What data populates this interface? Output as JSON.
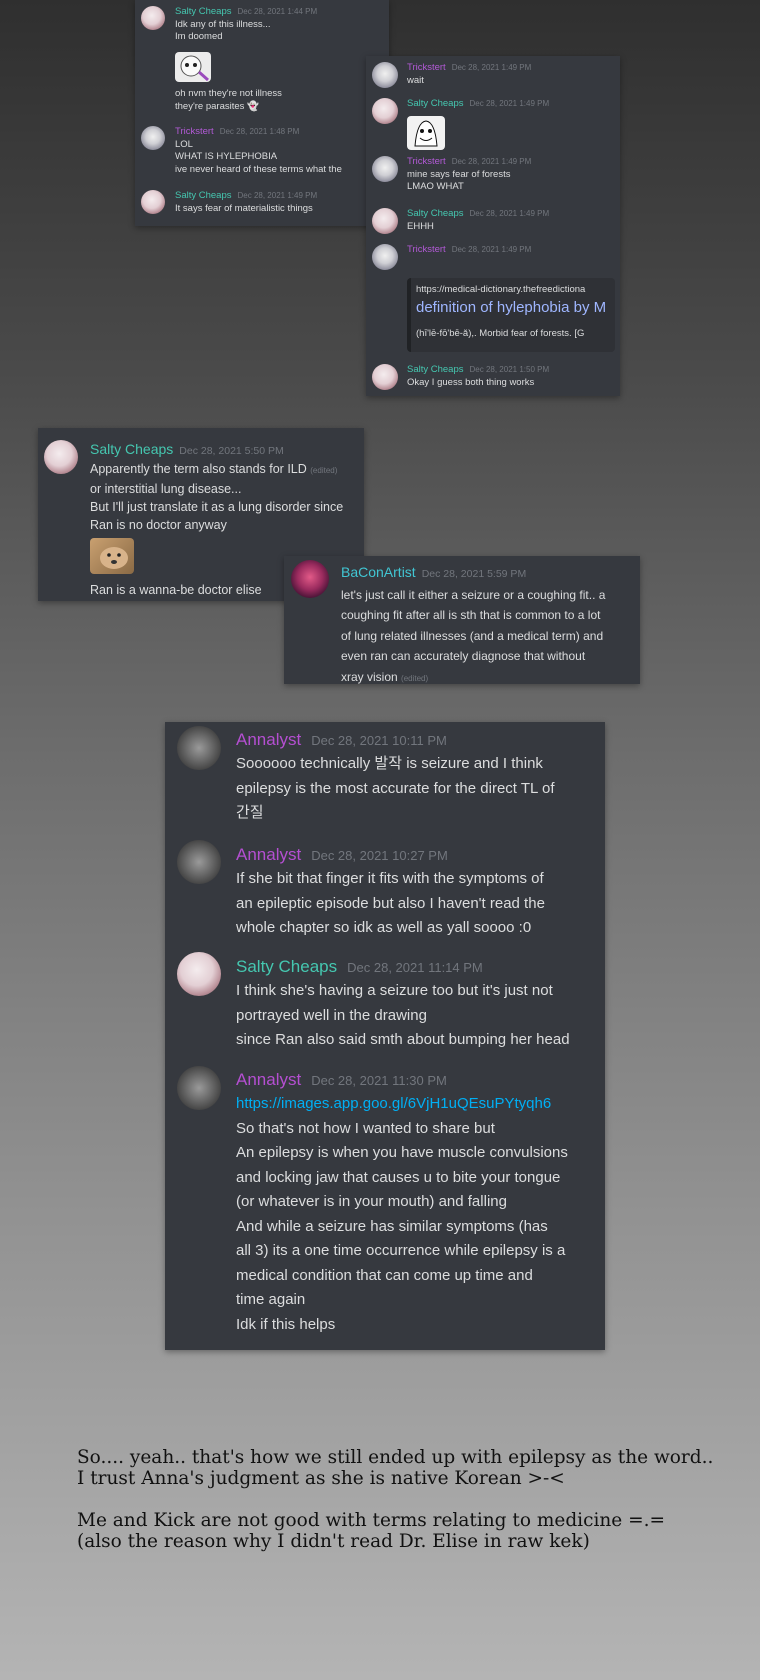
{
  "panel1": {
    "messages": [
      {
        "author": "Salty Cheaps",
        "time": "Dec 28, 2021 1:44 PM",
        "lines": [
          "Idk any of this illness...",
          "Im doomed"
        ]
      },
      {
        "lines": [
          "oh nvm they're not illness",
          "they're parasites"
        ]
      },
      {
        "author": "Trickstert",
        "time": "Dec 28, 2021 1:48 PM",
        "lines": [
          "LOL",
          "WHAT IS HYLEPHOBIA",
          "ive never heard of these terms what the"
        ]
      },
      {
        "author": "Salty Cheaps",
        "time": "Dec 28, 2021 1:49 PM",
        "lines": [
          "It says fear of materialistic things"
        ]
      }
    ]
  },
  "panel2": {
    "messages": [
      {
        "author": "Trickstert",
        "time": "Dec 28, 2021 1:49 PM",
        "lines": [
          "wait"
        ]
      },
      {
        "author": "Salty Cheaps",
        "time": "Dec 28, 2021 1:49 PM",
        "lines": []
      },
      {
        "author": "Trickstert",
        "time": "Dec 28, 2021 1:49 PM",
        "lines": [
          "mine says fear of forests",
          "LMAO WHAT"
        ]
      },
      {
        "author": "Salty Cheaps",
        "time": "Dec 28, 2021 1:49 PM",
        "lines": [
          "EHHH"
        ]
      },
      {
        "author": "Trickstert",
        "time": "Dec 28, 2021 1:49 PM",
        "lines": []
      },
      {
        "author": "Salty Cheaps",
        "time": "Dec 28, 2021 1:50 PM",
        "lines": [
          "Okay I guess both thing works"
        ]
      }
    ],
    "embed": {
      "url": "https://medical-dictionary.thefreedictiona",
      "title": "definition of hylephobia by M",
      "desc": "(hī'lē-fō'bē-ă),. Morbid fear of forests. [G"
    }
  },
  "panel3": {
    "author": "Salty Cheaps",
    "time": "Dec 28, 2021 5:50 PM",
    "edited": "(edited)",
    "lines": [
      "Apparently the term also stands for ILD",
      "or interstitial lung disease...",
      "But I'll just translate it as a lung disorder since",
      "Ran is no doctor anyway"
    ],
    "after": "Ran is a wanna-be doctor elise"
  },
  "panel4": {
    "author": "BaConArtist",
    "time": "Dec 28, 2021 5:59 PM",
    "edited": "(edited)",
    "lines": [
      "let's just call it either a seizure or a coughing fit.. a",
      "coughing fit after all is sth that is common to a lot",
      "of lung related illnesses (and a medical term) and",
      "even ran can accurately diagnose that without",
      "xray vision"
    ]
  },
  "panel5": {
    "messages": [
      {
        "author": "Annalyst",
        "time": "Dec 28, 2021 10:11 PM",
        "lines": [
          "Soooooo technically 발작 is seizure and I think",
          "epilepsy is the most accurate for the direct TL of",
          "간질"
        ]
      },
      {
        "author": "Annalyst",
        "time": "Dec 28, 2021 10:27 PM",
        "lines": [
          "If she bit that finger it fits with the symptoms of",
          "an epileptic episode but also I haven't read the",
          "whole chapter so idk as well as yall soooo :0"
        ]
      },
      {
        "author": "Salty Cheaps",
        "time": "Dec 28, 2021 11:14 PM",
        "lines": [
          "I think she's having a seizure too but it's just not",
          "portrayed well in the drawing",
          "since Ran also said smth about bumping her head"
        ]
      },
      {
        "author": "Annalyst",
        "time": "Dec 28, 2021 11:30 PM",
        "link": "https://images.app.goo.gl/6VjH1uQEsuPYtyqh6",
        "lines": [
          "So that's not how I wanted to share but",
          "An epilepsy is when you have muscle convulsions",
          "and locking jaw that causes u to bite your tongue",
          "(or whatever is in your mouth) and falling",
          "And while a seizure has similar symptoms (has",
          "all 3) its a one time occurrence while epilepsy is a",
          "medical condition that can come up time and",
          "time again",
          "Idk if this helps"
        ]
      }
    ]
  },
  "note": {
    "lines": [
      "So.... yeah.. that's how we still ended up with epilepsy as the word..",
      "I trust Anna's judgment as she is native Korean >-<",
      "",
      "Me and Kick are not good with terms relating to medicine =.=",
      "(also the reason why I didn't read Dr. Elise in raw kek)"
    ]
  },
  "colors": {
    "salty": "#45c7b0",
    "trickstert": "#b25ad6",
    "bacon": "#41c6d3",
    "annalyst": "#b44fd1",
    "panel": "#36393f",
    "link": "#00aff4"
  }
}
